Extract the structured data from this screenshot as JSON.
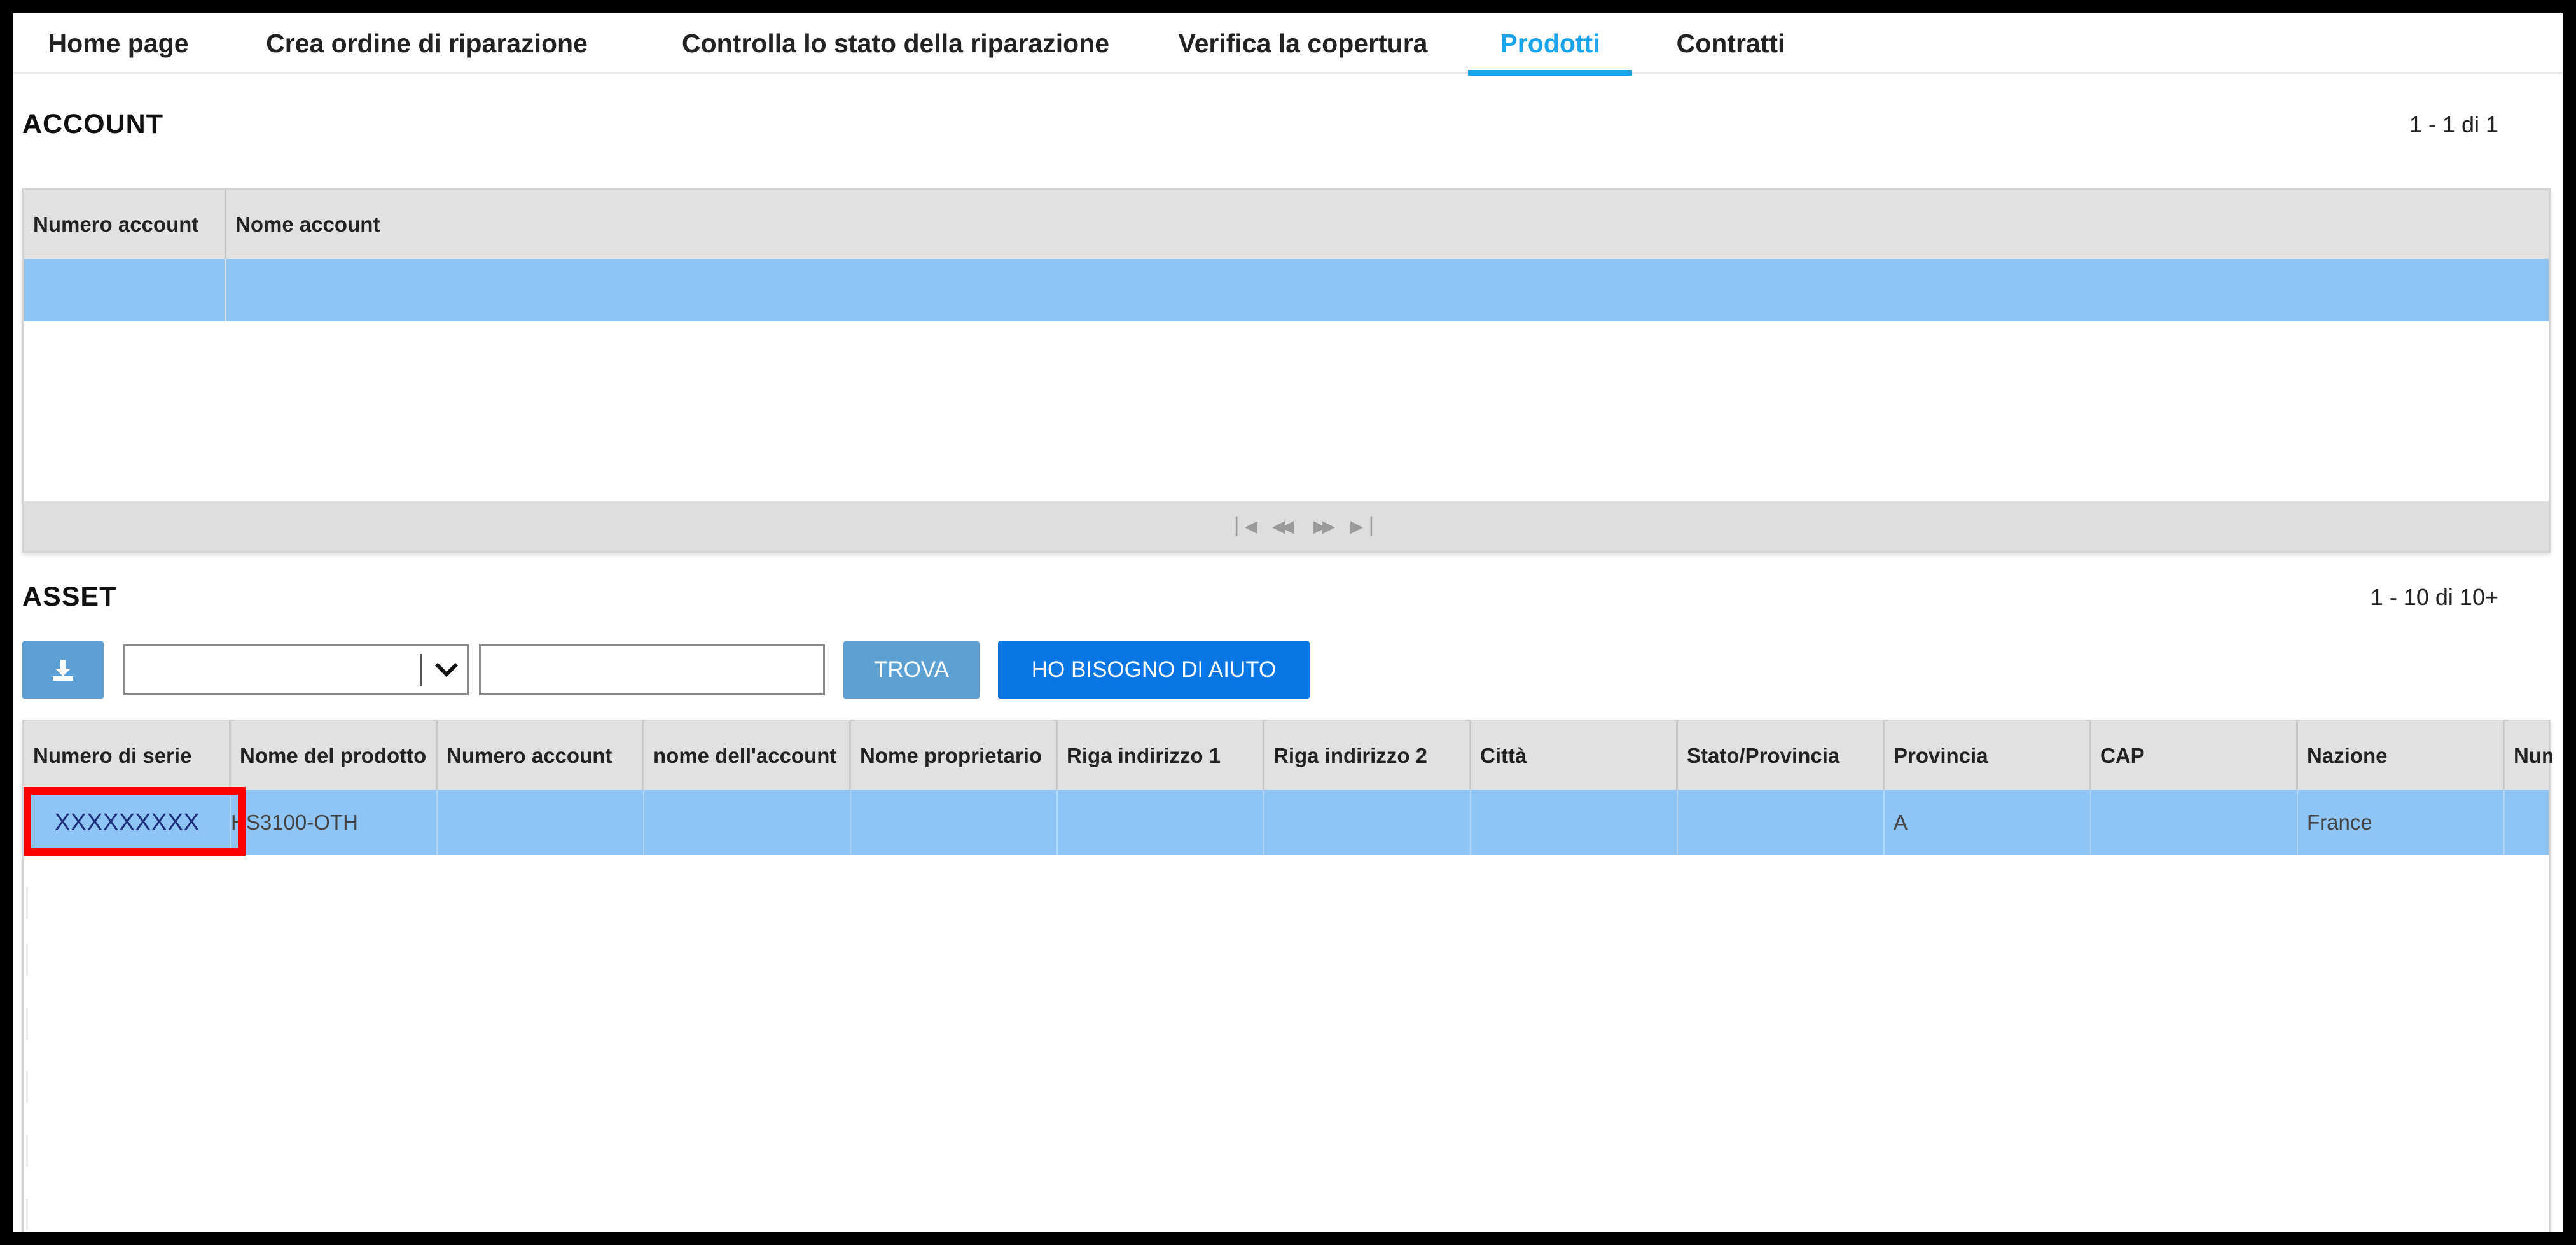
{
  "nav": {
    "tabs": [
      {
        "label": "Home page",
        "active": false
      },
      {
        "label": "Crea ordine di riparazione",
        "active": false
      },
      {
        "label": "Controlla lo stato della riparazione",
        "active": false
      },
      {
        "label": "Verifica la copertura",
        "active": false
      },
      {
        "label": "Prodotti",
        "active": true
      },
      {
        "label": "Contratti",
        "active": false
      }
    ]
  },
  "account": {
    "title": "ACCOUNT",
    "pager": "1 - 1 di 1",
    "columns": [
      "Numero account",
      "Nome account"
    ],
    "rows": [
      [
        "",
        ""
      ]
    ]
  },
  "asset": {
    "title": "ASSET",
    "pager": "1 - 10 di 10+",
    "toolbar": {
      "export_icon": "download-icon",
      "select_value": "",
      "search_value": "",
      "find_label": "TROVA",
      "help_label": "HO BISOGNO DI AIUTO"
    },
    "columns": [
      "Numero di serie",
      "Nome del prodotto",
      "Numero account",
      "nome dell'account",
      "Nome proprietario",
      "Riga indirizzo 1",
      "Riga indirizzo 2",
      "Città",
      "Stato/Provincia",
      "Provincia",
      "CAP",
      "Nazione",
      "Num"
    ],
    "rows": [
      [
        "XXXXXXXXX",
        "HS3100-OTH",
        "",
        "",
        "",
        "",
        "",
        "",
        "",
        "A",
        "",
        "France",
        ""
      ]
    ],
    "highlighted_cell": "Numero di serie"
  },
  "colors": {
    "accent": "#1aa3e8",
    "selected_row": "#8ec5f4",
    "header_bg": "#e1e1e1",
    "highlight": "#ff0000",
    "help_button": "#0a76e4",
    "find_button": "#5da1d3"
  }
}
